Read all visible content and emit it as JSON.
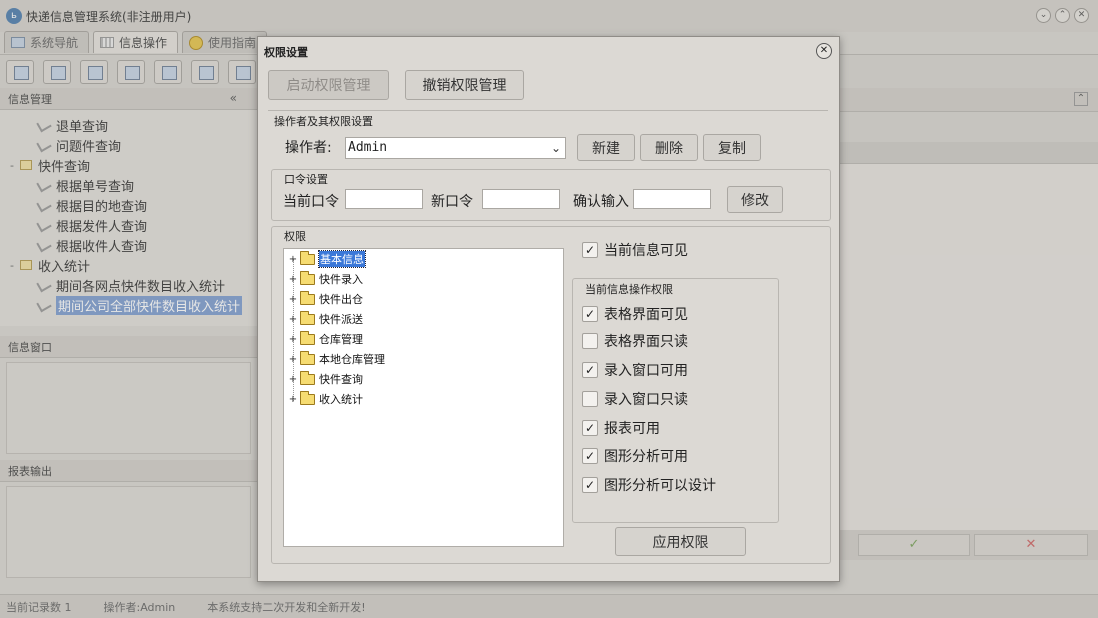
{
  "app": {
    "title": "快递信息管理系统(非注册用户)",
    "logo_text": "ь",
    "window_controls": [
      "⌄",
      "⌃",
      "✕"
    ]
  },
  "main_tabs": [
    {
      "label": "系统导航",
      "active": false
    },
    {
      "label": "信息操作",
      "active": true
    },
    {
      "label": "使用指南",
      "active": false
    }
  ],
  "left_panel": {
    "header": "信息管理",
    "collapse_glyph": "«",
    "tree": [
      {
        "label": "退单查询",
        "type": "leaf",
        "level": 2
      },
      {
        "label": "问题件查询",
        "type": "leaf",
        "level": 2
      },
      {
        "label": "快件查询",
        "type": "folder",
        "level": 1,
        "expander": "-"
      },
      {
        "label": "根据单号查询",
        "type": "leaf",
        "level": 2
      },
      {
        "label": "根据目的地查询",
        "type": "leaf",
        "level": 2
      },
      {
        "label": "根据发件人查询",
        "type": "leaf",
        "level": 2
      },
      {
        "label": "根据收件人查询",
        "type": "leaf",
        "level": 2
      },
      {
        "label": "收入统计",
        "type": "folder",
        "level": 1,
        "expander": "-"
      },
      {
        "label": "期间各网点快件数目收入统计",
        "type": "leaf",
        "level": 2
      },
      {
        "label": "期间公司全部快件数目收入统计",
        "type": "leaf",
        "level": 2,
        "selected": true
      }
    ],
    "info_header": "信息窗口",
    "report_header": "报表输出"
  },
  "right_panel": {
    "collapse_glyph": "⌃",
    "confirm_glyph": "✓",
    "cancel_glyph": "✕"
  },
  "status_bar": {
    "record_count": "当前记录数 1",
    "operator": "操作者:Admin",
    "message": "本系统支持二次开发和全新开发!"
  },
  "dialog": {
    "title": "权限设置",
    "close_glyph": "✕",
    "enable_button": "启动权限管理",
    "revoke_button": "撤销权限管理",
    "operator_section": {
      "title": "操作者及其权限设置",
      "label": "操作者:",
      "value": "Admin",
      "chevron": "⌄",
      "new_button": "新建",
      "delete_button": "删除",
      "copy_button": "复制"
    },
    "password_section": {
      "title": "口令设置",
      "current_label": "当前口令",
      "new_label": "新口令",
      "confirm_label": "确认输入",
      "current_value": "",
      "new_value": "",
      "confirm_value": "",
      "modify_button": "修改"
    },
    "permission_section": {
      "title": "权限",
      "tree": [
        {
          "label": "基本信息",
          "selected": true
        },
        {
          "label": "快件录入"
        },
        {
          "label": "快件出仓"
        },
        {
          "label": "快件派送"
        },
        {
          "label": "仓库管理"
        },
        {
          "label": "本地仓库管理"
        },
        {
          "label": "快件查询"
        },
        {
          "label": "收入统计"
        }
      ],
      "expand_glyph": "+",
      "current_visible": {
        "label": "当前信息可见",
        "checked": true
      },
      "ops_title": "当前信息操作权限",
      "ops": [
        {
          "label": "表格界面可见",
          "checked": true
        },
        {
          "label": "表格界面只读",
          "checked": false
        },
        {
          "label": "录入窗口可用",
          "checked": true
        },
        {
          "label": "录入窗口只读",
          "checked": false
        },
        {
          "label": "报表可用",
          "checked": true
        },
        {
          "label": "图形分析可用",
          "checked": true
        },
        {
          "label": "图形分析可以设计",
          "checked": true
        }
      ],
      "check_glyph": "✓",
      "apply_button": "应用权限"
    }
  }
}
